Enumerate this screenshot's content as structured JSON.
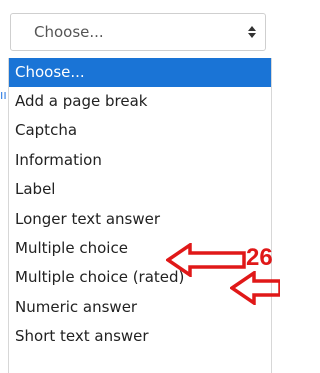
{
  "select": {
    "value": "Choose..."
  },
  "options": [
    {
      "label": "Choose...",
      "selected": true
    },
    {
      "label": "Add a page break",
      "selected": false
    },
    {
      "label": "Captcha",
      "selected": false
    },
    {
      "label": "Information",
      "selected": false
    },
    {
      "label": "Label",
      "selected": false
    },
    {
      "label": "Longer text answer",
      "selected": false
    },
    {
      "label": "Multiple choice",
      "selected": false
    },
    {
      "label": "Multiple choice (rated)",
      "selected": false
    },
    {
      "label": "Numeric answer",
      "selected": false
    },
    {
      "label": "Short text answer",
      "selected": false
    }
  ],
  "annotation": {
    "number": "26",
    "color": "#e01818"
  },
  "colors": {
    "highlight": "#1a74d6",
    "border": "#cfcfcf",
    "text": "#222222"
  }
}
